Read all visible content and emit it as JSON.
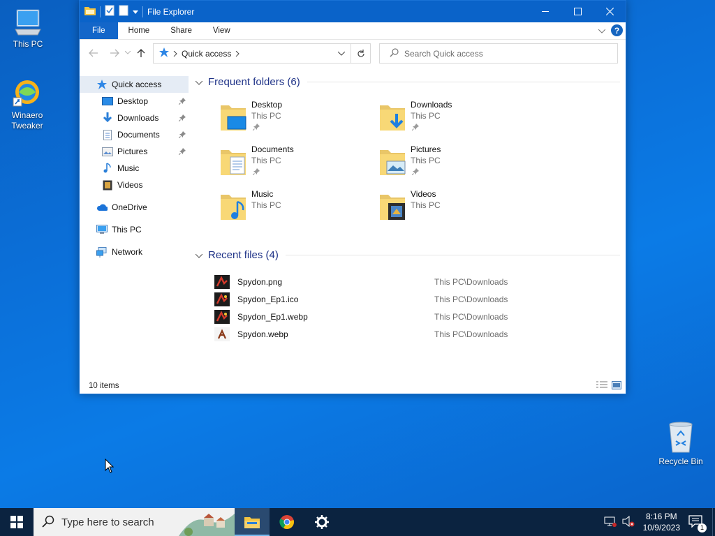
{
  "desktop": {
    "icons": [
      {
        "label": "This PC"
      },
      {
        "label": "Winaero\nTweaker"
      }
    ],
    "recycle_bin": "Recycle Bin"
  },
  "window": {
    "title": "File Explorer",
    "ribbon_tabs": [
      "File",
      "Home",
      "Share",
      "View"
    ],
    "help": "?",
    "address": {
      "location": "Quick access"
    },
    "search_placeholder": "Search Quick access"
  },
  "sidebar": {
    "items": [
      {
        "label": "Quick access",
        "icon": "star-icon",
        "selected": true
      },
      {
        "label": "Desktop",
        "icon": "desktop-icon",
        "pinned": true
      },
      {
        "label": "Downloads",
        "icon": "download-icon",
        "pinned": true
      },
      {
        "label": "Documents",
        "icon": "document-icon",
        "pinned": true
      },
      {
        "label": "Pictures",
        "icon": "picture-icon",
        "pinned": true
      },
      {
        "label": "Music",
        "icon": "music-icon"
      },
      {
        "label": "Videos",
        "icon": "video-icon"
      },
      {
        "label": "OneDrive",
        "icon": "cloud-icon"
      },
      {
        "label": "This PC",
        "icon": "computer-icon"
      },
      {
        "label": "Network",
        "icon": "network-icon"
      }
    ]
  },
  "frequent": {
    "header": "Frequent folders (6)",
    "folders": [
      {
        "name": "Desktop",
        "location": "This PC",
        "pinned": true
      },
      {
        "name": "Downloads",
        "location": "This PC",
        "pinned": true
      },
      {
        "name": "Documents",
        "location": "This PC",
        "pinned": true
      },
      {
        "name": "Pictures",
        "location": "This PC",
        "pinned": true
      },
      {
        "name": "Music",
        "location": "This PC",
        "pinned": false
      },
      {
        "name": "Videos",
        "location": "This PC",
        "pinned": false
      }
    ]
  },
  "recent": {
    "header": "Recent files (4)",
    "files": [
      {
        "name": "Spydon.png",
        "location": "This PC\\Downloads"
      },
      {
        "name": "Spydon_Ep1.ico",
        "location": "This PC\\Downloads"
      },
      {
        "name": "Spydon_Ep1.webp",
        "location": "This PC\\Downloads"
      },
      {
        "name": "Spydon.webp",
        "location": "This PC\\Downloads"
      }
    ]
  },
  "status": {
    "items": "10 items"
  },
  "taskbar": {
    "search_placeholder": "Type here to search",
    "time": "8:16 PM",
    "date": "10/9/2023",
    "notification_count": "1"
  },
  "colors": {
    "accent": "#0a63c9",
    "group_header": "#1e3287",
    "taskbar": "#0b2340"
  }
}
